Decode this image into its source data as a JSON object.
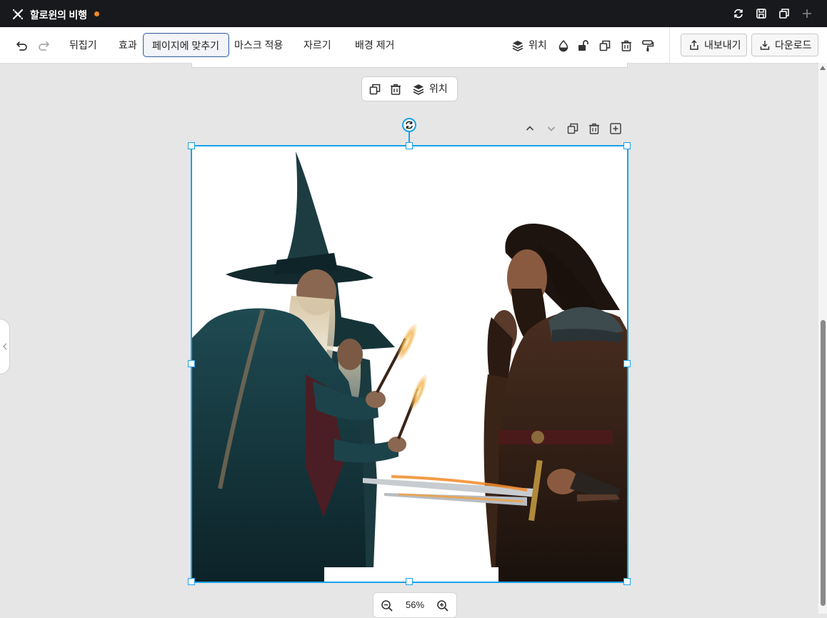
{
  "app": {
    "title": "할로윈의 비행",
    "unsaved_indicator_color": "#f08a24",
    "titlebar_icons": [
      "sync-icon",
      "save-icon",
      "duplicate-icon",
      "add-icon"
    ]
  },
  "toolbar": {
    "undo_icon": "undo-icon",
    "redo_icon": "redo-icon",
    "flip_label": "뒤집기",
    "effects_label": "효과",
    "fit_to_page_label": "페이지에 맞추기",
    "apply_mask_label": "마스크 적용",
    "crop_label": "자르기",
    "remove_bg_label": "배경 제거",
    "position_label": "위치",
    "right_icons": [
      "transparency-icon",
      "unlock-icon",
      "duplicate-icon",
      "trash-icon",
      "paint-roller-icon"
    ],
    "export_label": "내보내기",
    "download_label": "다운로드"
  },
  "floating_toolbar": {
    "position_label": "위치",
    "icons": [
      "duplicate-icon",
      "trash-icon",
      "layers-icon"
    ]
  },
  "page_controls": {
    "icons": [
      "chevron-up-icon",
      "chevron-down-icon",
      "duplicate-icon",
      "trash-icon",
      "add-page-icon"
    ]
  },
  "canvas": {
    "image_subject": "wizards-and-warriors-illustration",
    "selection_color": "#1aa1ea"
  },
  "zoom": {
    "value": "56%"
  }
}
